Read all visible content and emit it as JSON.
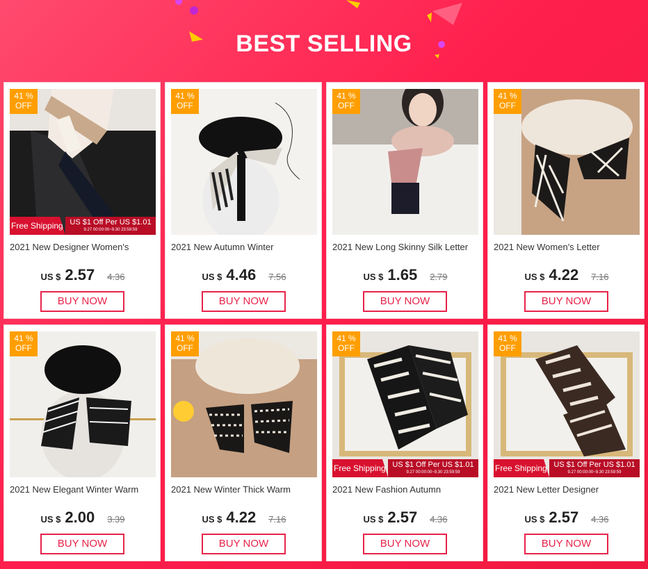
{
  "header": {
    "title": "BEST SELLING"
  },
  "colors": {
    "accent": "#e8234a",
    "discount_badge": "#ff9e00",
    "background": "#ff2a50"
  },
  "products": [
    {
      "discount_line1": "41 %",
      "discount_line2": "OFF",
      "title": "2021 New Designer Women's",
      "currency": "US $",
      "price": "2.57",
      "old_price": "4.36",
      "buy_label": "BUY NOW",
      "free_shipping": "Free Shipping",
      "promo": "US $1 Off Per US $1.01",
      "promo_sub": "9.27 00:00:00~9.30 23:59:59"
    },
    {
      "discount_line1": "41 %",
      "discount_line2": "OFF",
      "title": "2021 New Autumn Winter",
      "currency": "US $",
      "price": "4.46",
      "old_price": "7.56",
      "buy_label": "BUY NOW"
    },
    {
      "discount_line1": "41 %",
      "discount_line2": "OFF",
      "title": "2021 New Long Skinny Silk Letter",
      "currency": "US $",
      "price": "1.65",
      "old_price": "2.79",
      "buy_label": "BUY NOW"
    },
    {
      "discount_line1": "41 %",
      "discount_line2": "OFF",
      "title": "2021 New Women's Letter",
      "currency": "US $",
      "price": "4.22",
      "old_price": "7.16",
      "buy_label": "BUY NOW"
    },
    {
      "discount_line1": "41 %",
      "discount_line2": "OFF",
      "title": "2021 New Elegant Winter Warm",
      "currency": "US $",
      "price": "2.00",
      "old_price": "3.39",
      "buy_label": "BUY NOW"
    },
    {
      "discount_line1": "41 %",
      "discount_line2": "OFF",
      "title": "2021 New Winter Thick Warm",
      "currency": "US $",
      "price": "4.22",
      "old_price": "7.16",
      "buy_label": "BUY NOW"
    },
    {
      "discount_line1": "41 %",
      "discount_line2": "OFF",
      "title": "2021 New Fashion Autumn",
      "currency": "US $",
      "price": "2.57",
      "old_price": "4.36",
      "buy_label": "BUY NOW",
      "free_shipping": "Free Shipping",
      "promo": "US $1 Off Per US $1.01",
      "promo_sub": "9.27 00:00:00~9.30 23:59:59"
    },
    {
      "discount_line1": "41 %",
      "discount_line2": "OFF",
      "title": "2021 New Letter Designer",
      "currency": "US $",
      "price": "2.57",
      "old_price": "4.36",
      "buy_label": "BUY NOW",
      "free_shipping": "Free Shipping",
      "promo": "US $1 Off Per US $1.01",
      "promo_sub": "9.27 00:00:00~9.30 23:59:59"
    }
  ]
}
